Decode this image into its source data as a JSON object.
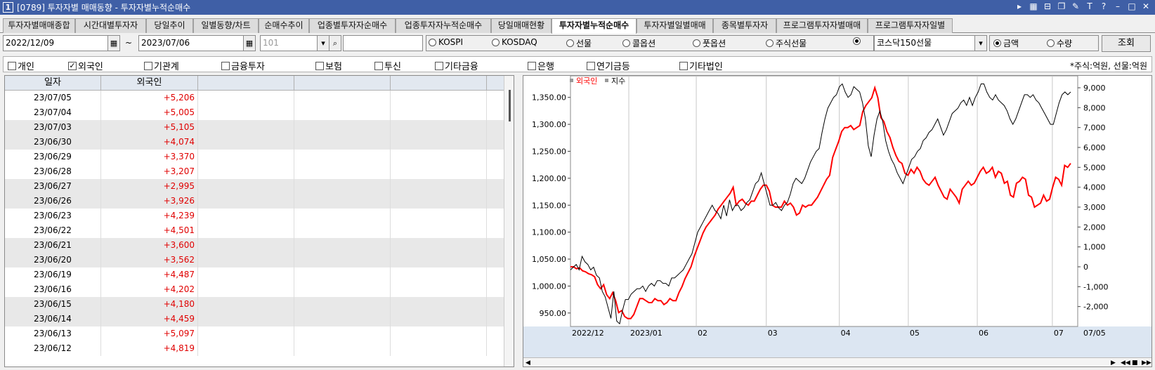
{
  "window": {
    "number": "1",
    "title": "[0789] 투자자별 매매동향 - 투자자별누적순매수"
  },
  "tabs": [
    "투자자별매매종합",
    "시간대별투자자",
    "당일추이",
    "일별동향/차트",
    "순매수추이",
    "업종별투자자순매수",
    "업종투자자누적순매수",
    "당일매매현황",
    "투자자별누적순매수",
    "투자자별일별매매",
    "종목별투자자",
    "프로그램투자자별매매",
    "프로그램투자자일별"
  ],
  "active_tab": "투자자별누적순매수",
  "toolbar": {
    "start_date": "2022/12/09",
    "tilde": "~",
    "end_date": "2023/07/06",
    "code": "101",
    "search_text": "",
    "radios": [
      "KOSPI",
      "KOSDAQ",
      "선물",
      "콜옵션",
      "풋옵션",
      "주식선물"
    ],
    "product": "코스닥150선물",
    "amount_label": "금액",
    "quantity_label": "수량",
    "search_button": "조회"
  },
  "checks": [
    {
      "label": "개인",
      "checked": false
    },
    {
      "label": "외국인",
      "checked": true
    },
    {
      "label": "기관계",
      "checked": false
    },
    {
      "label": "금융투자",
      "checked": false
    },
    {
      "label": "보험",
      "checked": false
    },
    {
      "label": "투신",
      "checked": false
    },
    {
      "label": "기타금융",
      "checked": false
    },
    {
      "label": "은행",
      "checked": false
    },
    {
      "label": "연기금등",
      "checked": false
    },
    {
      "label": "기타법인",
      "checked": false
    }
  ],
  "unit_note": "*주식:억원, 선물:억원",
  "table": {
    "headers": [
      "일자",
      "외국인",
      "",
      "",
      ""
    ],
    "rows": [
      [
        "23/07/05",
        "+5,206"
      ],
      [
        "23/07/04",
        "+5,005"
      ],
      [
        "23/07/03",
        "+5,105"
      ],
      [
        "23/06/30",
        "+4,074"
      ],
      [
        "23/06/29",
        "+3,370"
      ],
      [
        "23/06/28",
        "+3,207"
      ],
      [
        "23/06/27",
        "+2,995"
      ],
      [
        "23/06/26",
        "+3,926"
      ],
      [
        "23/06/23",
        "+4,239"
      ],
      [
        "23/06/22",
        "+4,501"
      ],
      [
        "23/06/21",
        "+3,600"
      ],
      [
        "23/06/20",
        "+3,562"
      ],
      [
        "23/06/19",
        "+4,487"
      ],
      [
        "23/06/16",
        "+4,202"
      ],
      [
        "23/06/15",
        "+4,180"
      ],
      [
        "23/06/14",
        "+4,459"
      ],
      [
        "23/06/13",
        "+5,097"
      ],
      [
        "23/06/12",
        "+4,819"
      ]
    ]
  },
  "chart_data": {
    "type": "line",
    "legend": [
      {
        "name": "외국인",
        "color": "#ff0000"
      },
      {
        "name": "지수",
        "color": "#000000"
      }
    ],
    "left_axis": {
      "ticks": [
        "1,350.00",
        "1,300.00",
        "1,250.00",
        "1,200.00",
        "1,150.00",
        "1,100.00",
        "1,050.00",
        "1,000.00",
        "950.00"
      ],
      "min": 925,
      "max": 1390
    },
    "right_axis": {
      "ticks": [
        "9,000",
        "8,000",
        "7,000",
        "6,000",
        "5,000",
        "4,000",
        "3,000",
        "2,000",
        "1,000",
        "0",
        "-1,000",
        "-2,000"
      ],
      "min": -3000,
      "max": 9600
    },
    "x_labels": [
      "2022/12",
      "2023/01",
      "02",
      "03",
      "04",
      "05",
      "06",
      "07",
      "07/05"
    ],
    "x_positions": [
      0,
      0.115,
      0.248,
      0.386,
      0.53,
      0.666,
      0.802,
      0.95,
      1.0
    ],
    "series": [
      {
        "name": "외국인",
        "color": "#ff0000",
        "axis": "right",
        "values": [
          0,
          0,
          -100,
          -50,
          -200,
          -250,
          -350,
          -400,
          -500,
          -900,
          -1100,
          -900,
          -1400,
          -1600,
          -1300,
          -1700,
          -2300,
          -2200,
          -2500,
          -2600,
          -2600,
          -2400,
          -2000,
          -1600,
          -1600,
          -1700,
          -1800,
          -1800,
          -1600,
          -1700,
          -1700,
          -1900,
          -1800,
          -1600,
          -1700,
          -1700,
          -1300,
          -1000,
          -600,
          -300,
          0,
          500,
          900,
          1300,
          1700,
          2000,
          2200,
          2400,
          2600,
          2900,
          3100,
          3300,
          3500,
          3700,
          4000,
          3100,
          3300,
          3400,
          3200,
          3100,
          3300,
          3300,
          3600,
          3900,
          4100,
          4100,
          3800,
          3100,
          3000,
          3000,
          3000,
          3300,
          3100,
          3200,
          3000,
          2600,
          2700,
          3100,
          3000,
          3100,
          3100,
          3300,
          3500,
          3800,
          4100,
          4400,
          4600,
          5500,
          5900,
          6300,
          6800,
          7000,
          7000,
          7100,
          6900,
          7000,
          7100,
          7800,
          8100,
          8300,
          8500,
          9000,
          8500,
          7500,
          7300,
          6800,
          6500,
          6000,
          5600,
          5300,
          5200,
          4700,
          4600,
          4900,
          4700,
          5000,
          4800,
          4400,
          4200,
          4100,
          4300,
          4500,
          4100,
          3800,
          3500,
          3400,
          3900,
          3700,
          3500,
          3200,
          3900,
          4100,
          4300,
          4100,
          4200,
          4500,
          4800,
          5000,
          4700,
          4800,
          5000,
          4500,
          4800,
          4700,
          4200,
          4300,
          3600,
          3500,
          4200,
          4300,
          4500,
          4400,
          3600,
          3500,
          3000,
          3100,
          3200,
          3600,
          3300,
          3400,
          4000,
          4500,
          4400,
          4100,
          5100,
          5000,
          5200
        ]
      },
      {
        "name": "지수",
        "color": "#000000",
        "axis": "left",
        "values": [
          1030,
          1035,
          1040,
          1030,
          1055,
          1045,
          1040,
          1030,
          1035,
          1020,
          1015,
          990,
          980,
          960,
          940,
          990,
          935,
          930,
          955,
          975,
          975,
          985,
          990,
          995,
          995,
          1000,
          990,
          1000,
          1005,
          1000,
          1010,
          1010,
          1005,
          1005,
          1000,
          1015,
          1015,
          1020,
          1025,
          1030,
          1040,
          1050,
          1060,
          1080,
          1100,
          1110,
          1120,
          1130,
          1140,
          1150,
          1140,
          1135,
          1125,
          1150,
          1130,
          1160,
          1140,
          1150,
          1150,
          1140,
          1145,
          1155,
          1160,
          1175,
          1190,
          1195,
          1210,
          1190,
          1170,
          1150,
          1150,
          1155,
          1145,
          1140,
          1150,
          1155,
          1170,
          1190,
          1200,
          1195,
          1190,
          1200,
          1215,
          1230,
          1240,
          1250,
          1255,
          1285,
          1310,
          1330,
          1340,
          1350,
          1355,
          1370,
          1375,
          1360,
          1350,
          1355,
          1370,
          1365,
          1360,
          1340,
          1310,
          1260,
          1240,
          1280,
          1310,
          1325,
          1305,
          1270,
          1250,
          1235,
          1225,
          1210,
          1200,
          1190,
          1205,
          1220,
          1235,
          1240,
          1250,
          1255,
          1270,
          1275,
          1285,
          1290,
          1300,
          1310,
          1295,
          1280,
          1290,
          1305,
          1320,
          1325,
          1330,
          1340,
          1345,
          1335,
          1350,
          1335,
          1350,
          1360,
          1375,
          1375,
          1360,
          1350,
          1345,
          1355,
          1345,
          1340,
          1335,
          1325,
          1310,
          1300,
          1310,
          1325,
          1340,
          1355,
          1355,
          1350,
          1355,
          1345,
          1340,
          1330,
          1320,
          1310,
          1300,
          1300,
          1320,
          1340,
          1355,
          1360,
          1355,
          1360
        ]
      }
    ]
  }
}
